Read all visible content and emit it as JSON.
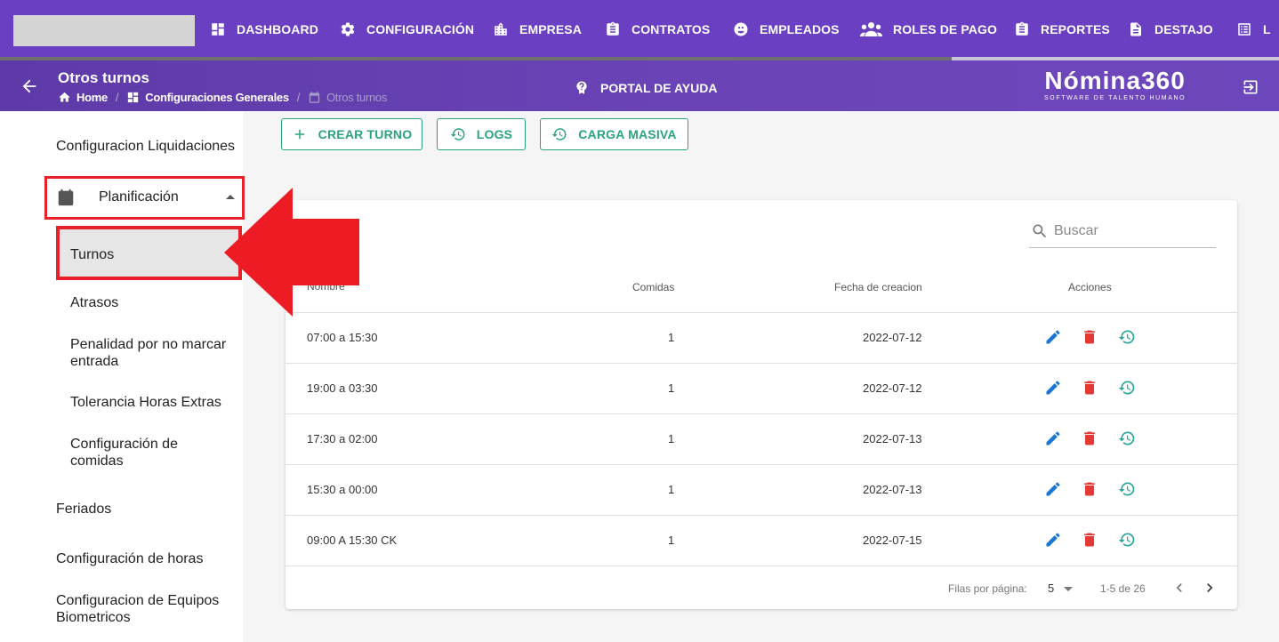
{
  "nav": {
    "items": [
      {
        "label": "DASHBOARD",
        "icon": "dashboard-icon"
      },
      {
        "label": "CONFIGURACIÓN",
        "icon": "gear-icon"
      },
      {
        "label": "EMPRESA",
        "icon": "building-icon"
      },
      {
        "label": "CONTRATOS",
        "icon": "clipboard-icon"
      },
      {
        "label": "EMPLEADOS",
        "icon": "face-icon"
      },
      {
        "label": "ROLES DE PAGO",
        "icon": "group-icon"
      },
      {
        "label": "REPORTES",
        "icon": "report-icon"
      },
      {
        "label": "DESTAJO",
        "icon": "document-icon"
      },
      {
        "label": "L",
        "icon": "list-icon"
      }
    ]
  },
  "header": {
    "title": "Otros turnos",
    "breadcrumb": [
      "Home",
      "Configuraciones Generales",
      "Otros turnos"
    ],
    "help_label": "PORTAL DE AYUDA",
    "brand_name": "Nómina360",
    "brand_tagline": "SOFTWARE DE TALENTO HUMANO"
  },
  "sidebar": {
    "config_liquidaciones": "Configuracion Liquidaciones",
    "planificacion": "Planificación",
    "sub_items": [
      "Turnos",
      "Atrasos",
      "Penalidad por no marcar entrada",
      "Tolerancia Horas Extras",
      "Configuración de comidas"
    ],
    "feriados": "Feriados",
    "config_horas": "Configuración de horas",
    "config_biometricos": "Configuracion de Equipos Biometricos"
  },
  "toolbar": {
    "create_label": "CREAR TURNO",
    "logs_label": "LOGS",
    "bulk_label": "CARGA MASIVA"
  },
  "table": {
    "search_placeholder": "Buscar",
    "headers": [
      "Nombre",
      "Comidas",
      "Fecha de creacion",
      "Acciones"
    ],
    "rows": [
      {
        "nombre": "07:00 a 15:30",
        "comidas": "1",
        "fecha": "2022-07-12"
      },
      {
        "nombre": "19:00 a 03:30",
        "comidas": "1",
        "fecha": "2022-07-12"
      },
      {
        "nombre": "17:30 a 02:00",
        "comidas": "1",
        "fecha": "2022-07-13"
      },
      {
        "nombre": "15:30 a 00:00",
        "comidas": "1",
        "fecha": "2022-07-13"
      },
      {
        "nombre": "09:00 A 15:30 CK",
        "comidas": "1",
        "fecha": "2022-07-15"
      }
    ],
    "rows_per_page_label": "Filas por página:",
    "rows_per_page": "5",
    "range": "1-5 de 26"
  },
  "colors": {
    "primary": "#6a3fc1",
    "accent_green": "#2aa37e",
    "edit_blue": "#1976d2",
    "delete_red": "#e53935",
    "history_teal": "#26a69a",
    "highlight_red": "#e8202a"
  }
}
